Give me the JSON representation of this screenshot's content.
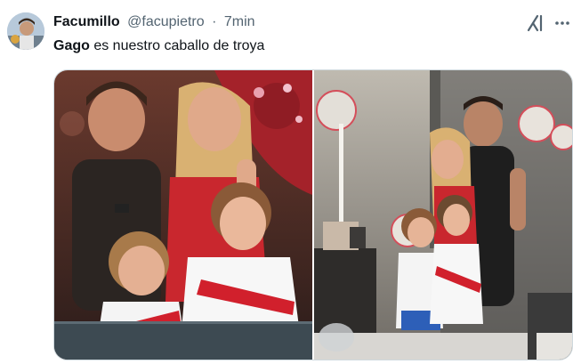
{
  "tweet": {
    "author_name": "Facumillo",
    "handle": "@facupietro",
    "separator": "·",
    "time": "7min",
    "text_bold": "Gago",
    "text_rest": " es nuestro caballo de troya"
  },
  "icons": {
    "avatar": "avatar",
    "grok": "grok-icon",
    "more": "more-options-icon"
  },
  "media": {
    "count": 2,
    "photos": [
      "family-photo-left",
      "family-photo-right"
    ]
  },
  "colors": {
    "text": "#0f1419",
    "secondary": "#536471",
    "border": "#cfd9de",
    "jersey_red": "#d1202c"
  }
}
